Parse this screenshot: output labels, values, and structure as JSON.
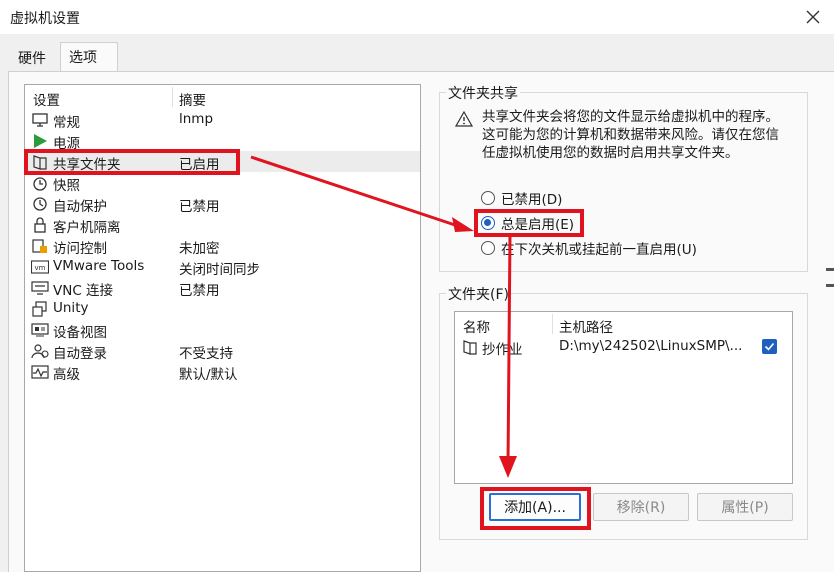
{
  "window": {
    "title": "虚拟机设置",
    "close_icon": "close-icon"
  },
  "tabs": [
    {
      "label": "硬件"
    },
    {
      "label": "选项"
    }
  ],
  "settings": {
    "header": {
      "col_setting": "设置",
      "col_summary": "摘要"
    },
    "items": [
      {
        "name": "常规",
        "summary": "lnmp",
        "icon": "monitor-icon"
      },
      {
        "name": "电源",
        "summary": "",
        "icon": "play-icon"
      },
      {
        "name": "共享文件夹",
        "summary": "已启用",
        "icon": "shared-folder-icon"
      },
      {
        "name": "快照",
        "summary": "",
        "icon": "snapshot-icon"
      },
      {
        "name": "自动保护",
        "summary": "已禁用",
        "icon": "autoprotect-icon"
      },
      {
        "name": "客户机隔离",
        "summary": "",
        "icon": "lock-icon"
      },
      {
        "name": "访问控制",
        "summary": "未加密",
        "icon": "access-control-icon"
      },
      {
        "name": "VMware Tools",
        "summary": "关闭时间同步",
        "icon": "vm-icon"
      },
      {
        "name": "VNC 连接",
        "summary": "已禁用",
        "icon": "vnc-icon"
      },
      {
        "name": "Unity",
        "summary": "",
        "icon": "unity-icon"
      },
      {
        "name": "设备视图",
        "summary": "",
        "icon": "device-view-icon"
      },
      {
        "name": "自动登录",
        "summary": "不受支持",
        "icon": "autologin-icon"
      },
      {
        "name": "高级",
        "summary": "默认/默认",
        "icon": "advanced-icon"
      }
    ]
  },
  "sharing": {
    "group_title": "文件夹共享",
    "warning": "共享文件夹会将您的文件显示给虚拟机中的程序。这可能为您的计算机和数据带来风险。请仅在您信任虚拟机使用您的数据时启用共享文件夹。",
    "options": [
      {
        "label": "已禁用(D)",
        "checked": false
      },
      {
        "label": "总是启用(E)",
        "checked": true
      },
      {
        "label": "在下次关机或挂起前一直启用(U)",
        "checked": false
      }
    ]
  },
  "folders": {
    "group_title": "文件夹(F)",
    "columns": {
      "name": "名称",
      "path": "主机路径"
    },
    "rows": [
      {
        "name": "抄作业",
        "path": "D:\\my\\242502\\LinuxSMP\\...",
        "enabled": true
      }
    ],
    "buttons": {
      "add": "添加(A)...",
      "remove": "移除(R)",
      "properties": "属性(P)"
    }
  },
  "colors": {
    "highlight": "#e0141e",
    "accent": "#1f5fbf",
    "play": "#2a9d3a"
  }
}
